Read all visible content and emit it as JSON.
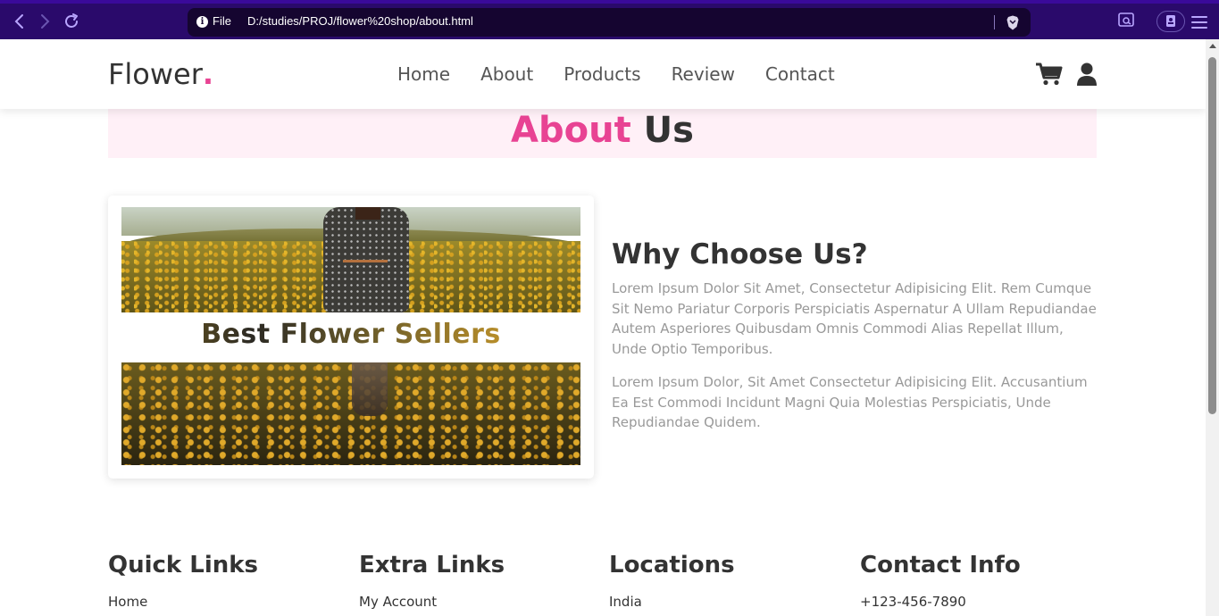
{
  "browser": {
    "scheme_label": "File",
    "url": "D:/studies/PROJ/flower%20shop/about.html"
  },
  "header": {
    "logo_text": "Flower",
    "logo_dot": ".",
    "nav": [
      "Home",
      "About",
      "Products",
      "Review",
      "Contact"
    ]
  },
  "about": {
    "heading_accent": "About",
    "heading_rest": "Us",
    "video_caption": "Best Flower Sellers",
    "title": "Why Choose Us?",
    "paragraph1": "Lorem Ipsum Dolor Sit Amet, Consectetur Adipisicing Elit. Rem Cumque Sit Nemo Pariatur Corporis Perspiciatis Aspernatur A Ullam Repudiandae Autem Asperiores Quibusdam Omnis Commodi Alias Repellat Illum, Unde Optio Temporibus.",
    "paragraph2": "Lorem Ipsum Dolor, Sit Amet Consectetur Adipisicing Elit. Accusantium Ea Est Commodi Incidunt Magni Quia Molestias Perspiciatis, Unde Repudiandae Quidem."
  },
  "footer": {
    "columns": [
      {
        "title": "Quick Links",
        "first_item": "Home"
      },
      {
        "title": "Extra Links",
        "first_item": "My Account"
      },
      {
        "title": "Locations",
        "first_item": "India"
      },
      {
        "title": "Contact Info",
        "first_item": "+123-456-7890"
      }
    ]
  },
  "colors": {
    "accent": "#e84393",
    "heading_band_bg": "#fff0f7",
    "browser_bar": "#2a0a6b",
    "text_dark": "#333333",
    "text_muted": "#999999"
  },
  "icons": [
    "back-icon",
    "forward-icon",
    "reload-icon",
    "info-icon",
    "brave-shield-icon",
    "extension-icon",
    "wallet-icon",
    "menu-icon",
    "cart-icon",
    "user-icon"
  ]
}
